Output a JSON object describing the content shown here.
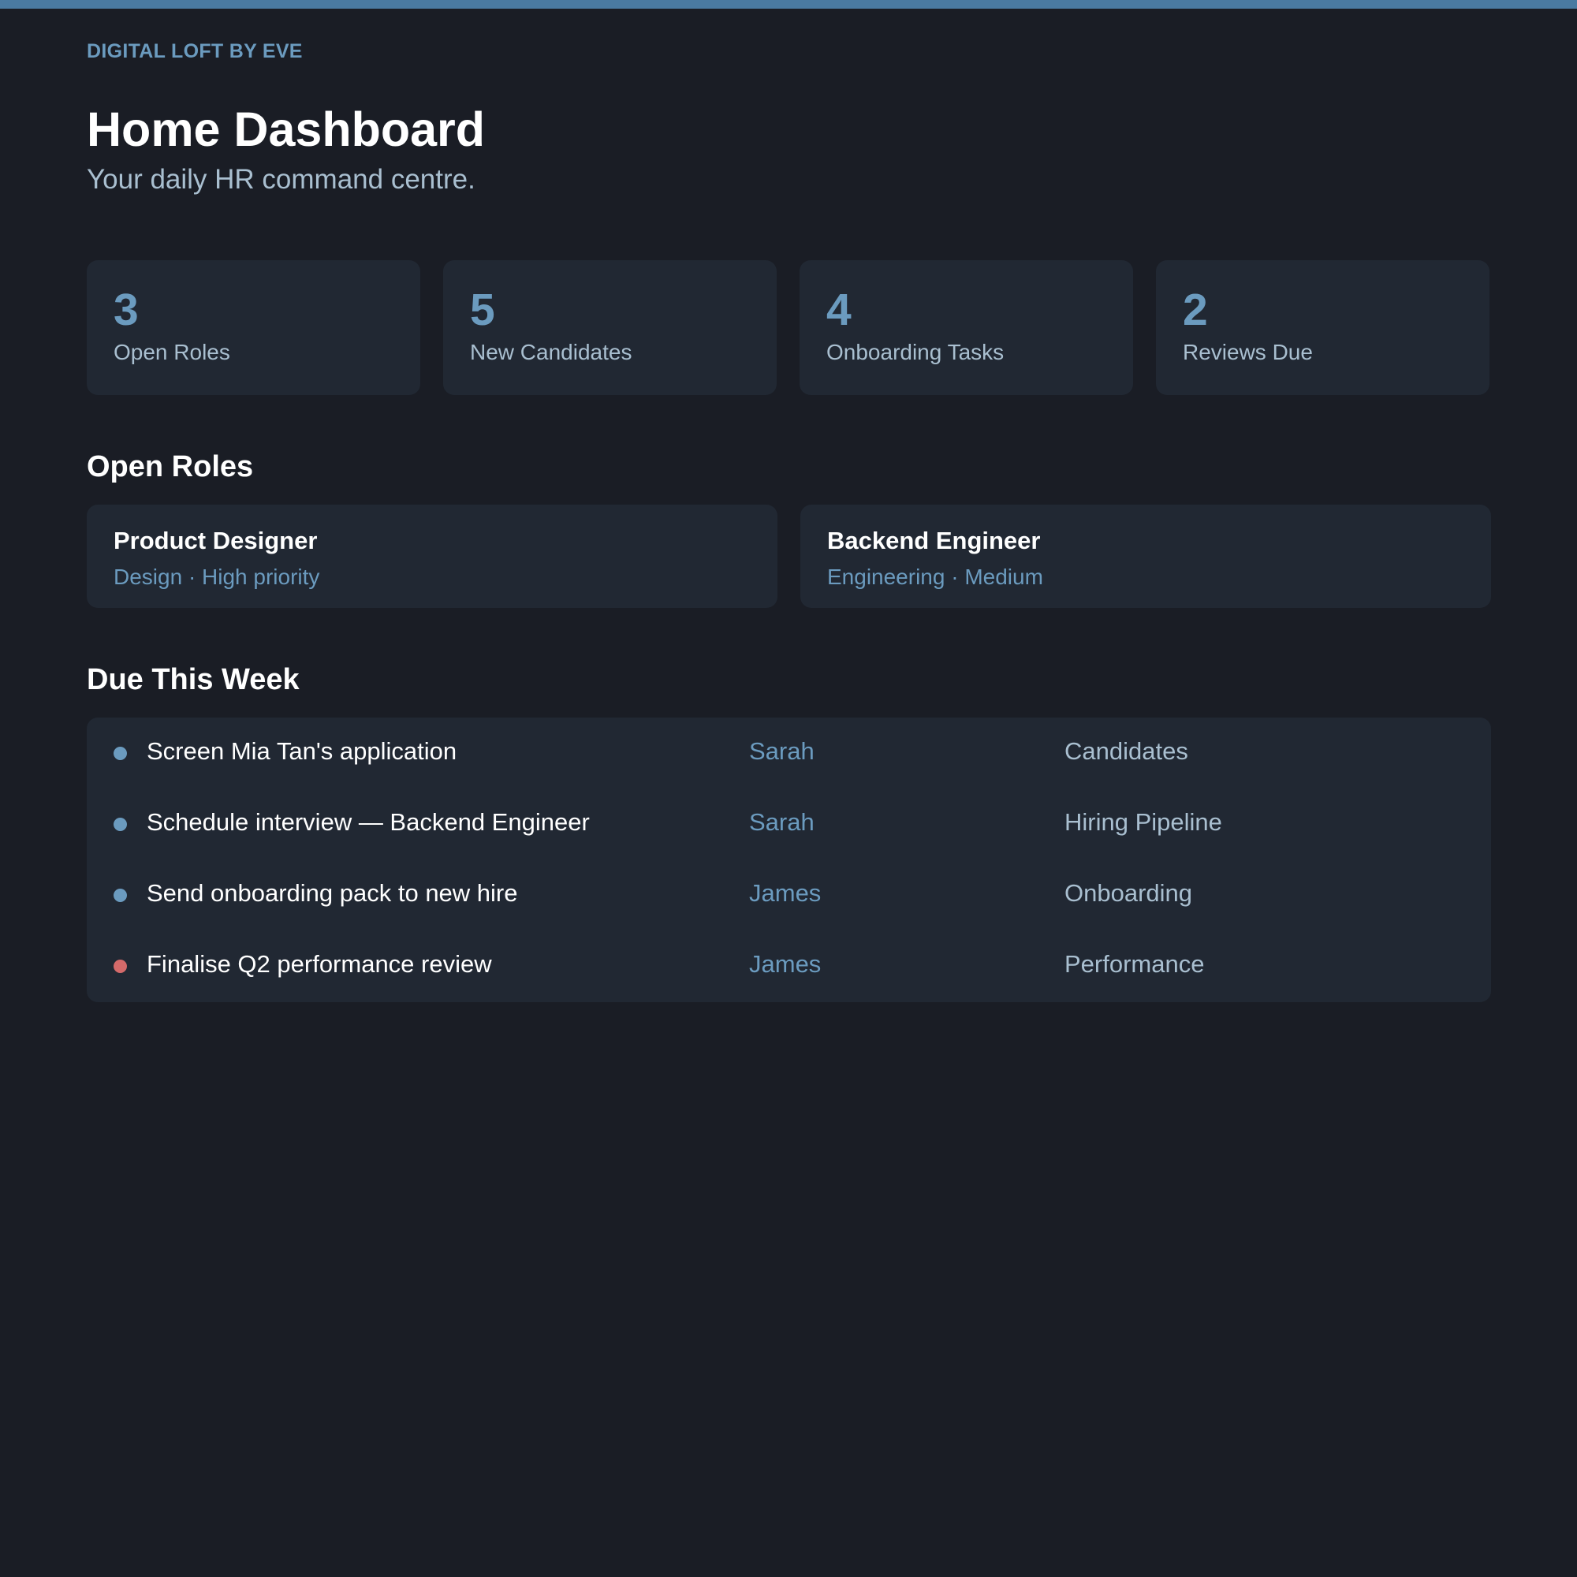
{
  "brand": "DIGITAL LOFT BY EVE",
  "header": {
    "title": "Home Dashboard",
    "subtitle": "Your daily HR command centre."
  },
  "stats": [
    {
      "value": "3",
      "label": "Open Roles"
    },
    {
      "value": "5",
      "label": "New Candidates"
    },
    {
      "value": "4",
      "label": "Onboarding Tasks"
    },
    {
      "value": "2",
      "label": "Reviews Due"
    }
  ],
  "open_roles": {
    "title": "Open Roles",
    "items": [
      {
        "title": "Product Designer",
        "meta": "Design · High priority"
      },
      {
        "title": "Backend Engineer",
        "meta": "Engineering · Medium"
      }
    ]
  },
  "due_this_week": {
    "title": "Due This Week",
    "items": [
      {
        "task": "Screen Mia Tan's application",
        "owner": "Sarah",
        "area": "Candidates",
        "status_color": "#6b9bbf"
      },
      {
        "task": "Schedule interview — Backend Engineer",
        "owner": "Sarah",
        "area": "Hiring Pipeline",
        "status_color": "#6b9bbf"
      },
      {
        "task": "Send onboarding pack to new hire",
        "owner": "James",
        "area": "Onboarding",
        "status_color": "#6b9bbf"
      },
      {
        "task": "Finalise Q2 performance review",
        "owner": "James",
        "area": "Performance",
        "status_color": "#d46a6a"
      }
    ]
  },
  "colors": {
    "background": "#1a1d25",
    "card": "#212833",
    "accent": "#6b9bbf",
    "top_bar": "#4a7aa1",
    "muted_text": "#a9bfd0",
    "alert": "#d46a6a"
  }
}
